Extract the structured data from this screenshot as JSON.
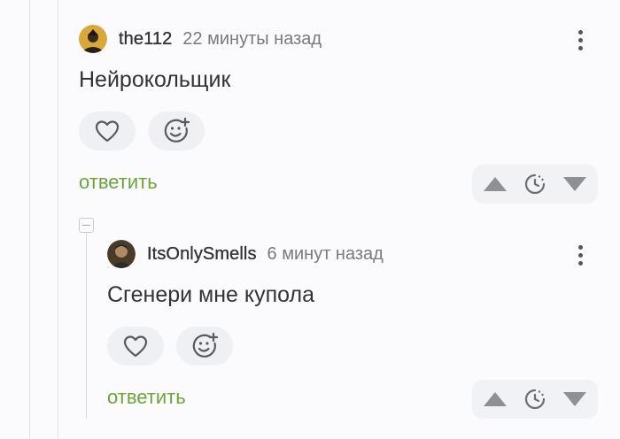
{
  "comments": [
    {
      "username": "the112",
      "time": "22 минуты назад",
      "text": "Нейрокольщик",
      "reply_label": "ответить",
      "reactions": [
        "heart-icon",
        "add-reaction-icon"
      ],
      "vote_icons": [
        "upvote-icon",
        "save-later-icon",
        "downvote-icon"
      ]
    },
    {
      "username": "ItsOnlySmells",
      "time": "6 минут назад",
      "text": "Сгенери мне купола",
      "reply_label": "ответить",
      "reactions": [
        "heart-icon",
        "add-reaction-icon"
      ],
      "vote_icons": [
        "upvote-icon",
        "save-later-icon",
        "downvote-icon"
      ]
    }
  ],
  "colors": {
    "reply_link": "#6da33a",
    "background": "#fbfbfd",
    "pill": "#eef0f3"
  }
}
